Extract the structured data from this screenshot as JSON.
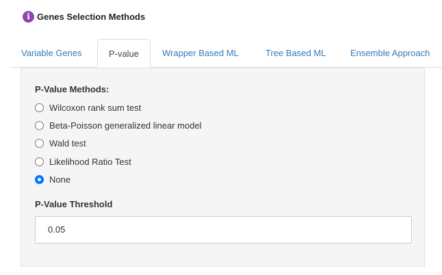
{
  "header": {
    "icon": "info-icon",
    "icon_glyph": "i",
    "title": "Genes Selection Methods"
  },
  "tabs": [
    {
      "label": "Variable Genes",
      "active": false
    },
    {
      "label": "P-value",
      "active": true
    },
    {
      "label": "Wrapper Based ML",
      "active": false
    },
    {
      "label": "Tree Based ML",
      "active": false
    },
    {
      "label": "Ensemble Approach",
      "active": false
    }
  ],
  "pvalue_methods": {
    "label": "P-Value Methods:",
    "options": [
      {
        "label": "Wilcoxon rank sum test",
        "selected": false
      },
      {
        "label": "Beta-Poisson generalized linear model",
        "selected": false
      },
      {
        "label": "Wald test",
        "selected": false
      },
      {
        "label": "Likelihood Ratio Test",
        "selected": false
      },
      {
        "label": "None",
        "selected": true
      }
    ]
  },
  "pvalue_threshold": {
    "label": "P-Value Threshold",
    "value": "0.05"
  },
  "colors": {
    "accent": "#337ab7",
    "icon": "#8e44ad",
    "radio_selected": "#0075ff",
    "panel_bg": "#f5f5f5"
  }
}
